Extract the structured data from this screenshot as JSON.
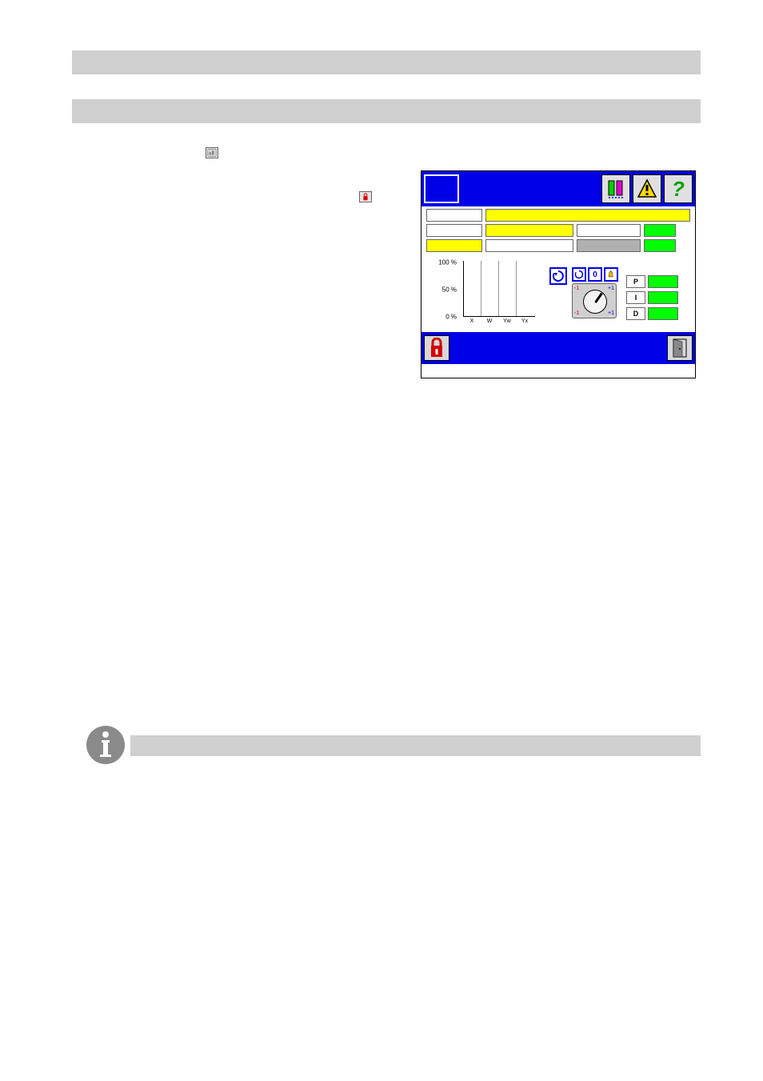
{
  "inline_icons": {
    "controller_icon_alt": "controller-icon",
    "lock_icon_alt": "lock-icon"
  },
  "panel": {
    "top_buttons": {
      "bars_icon": "bar-chart-icon",
      "warning_icon": "warning-icon",
      "help_icon": "help-icon",
      "help_label": "?"
    },
    "rows": {
      "row1": {
        "c1": "",
        "c2": ""
      },
      "row2": {
        "c1": "",
        "c2": "",
        "c3": "",
        "c4": ""
      },
      "row3": {
        "c1": "",
        "c2": "",
        "c3": "",
        "c4": ""
      }
    },
    "pid": {
      "p_label": "P",
      "i_label": "I",
      "d_label": "D"
    },
    "dial": {
      "zero_label": "0",
      "tl": "-1",
      "tr": "+1",
      "bl": "-1",
      "br": "+1"
    },
    "bottom": {
      "lock_icon": "lock-icon",
      "exit_icon": "exit-icon"
    }
  },
  "info": {
    "icon_alt": "info-icon"
  },
  "chart_data": {
    "type": "bar",
    "categories": [
      "X",
      "W",
      "Yw",
      "Yx"
    ],
    "values": [
      0,
      0,
      0,
      0
    ],
    "title": "",
    "xlabel": "",
    "ylabel": "",
    "ylim": [
      0,
      100
    ],
    "yticks": [
      "100 %",
      "50 %",
      "0 %"
    ]
  }
}
